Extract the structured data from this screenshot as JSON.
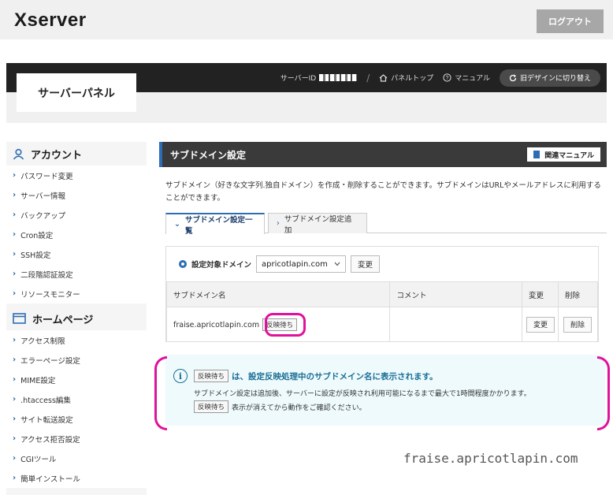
{
  "topbar": {
    "logo": "Xserver",
    "logout_label": "ログアウト"
  },
  "panel": {
    "title": "サーバーパネル",
    "server_id_label": "サーバーID",
    "panel_top_label": "パネルトップ",
    "manual_label": "マニュアル",
    "old_design_label": "旧デザインに切り替え"
  },
  "sidebar": {
    "account": {
      "heading": "アカウント",
      "items": [
        "パスワード変更",
        "サーバー情報",
        "バックアップ",
        "Cron設定",
        "SSH設定",
        "二段階認証設定",
        "リソースモニター"
      ]
    },
    "homepage": {
      "heading": "ホームページ",
      "items": [
        "アクセス制限",
        "エラーページ設定",
        "MIME設定",
        ".htaccess編集",
        "サイト転送設定",
        "アクセス拒否設定",
        "CGIツール",
        "簡単インストール"
      ]
    }
  },
  "main": {
    "title": "サブドメイン設定",
    "manual_button": "関連マニュアル",
    "description": "サブドメイン（好きな文字列.独自ドメイン）を作成・削除することができます。サブドメインはURLやメールアドレスに利用することができます。",
    "tabs": [
      "サブドメイン設定一覧",
      "サブドメイン設定追加"
    ],
    "domain_label": "設定対象ドメイン",
    "domain_value": "apricotlapin.com",
    "change_label": "変更",
    "table": {
      "headers": [
        "サブドメイン名",
        "コメント",
        "変更",
        "削除"
      ],
      "rows": [
        {
          "name": "fraise.apricotlapin.com",
          "badge": "反映待ち",
          "comment": "",
          "change": "変更",
          "delete": "削除"
        }
      ]
    },
    "info": {
      "badge": "反映待ち",
      "title_text": "は、設定反映処理中のサブドメイン名に表示されます。",
      "line1": "サブドメイン設定は追加後、サーバーに設定が反映され利用可能になるまで最大で1時間程度かかります。",
      "line2_badge": "反映待ち",
      "line2_text": "表示が消えてから動作をご確認ください。"
    }
  },
  "watermark": "fraise.apricotlapin.com",
  "colors": {
    "accent": "#2c6db3",
    "highlight": "#e0119c",
    "info_bg": "#eefafc"
  }
}
